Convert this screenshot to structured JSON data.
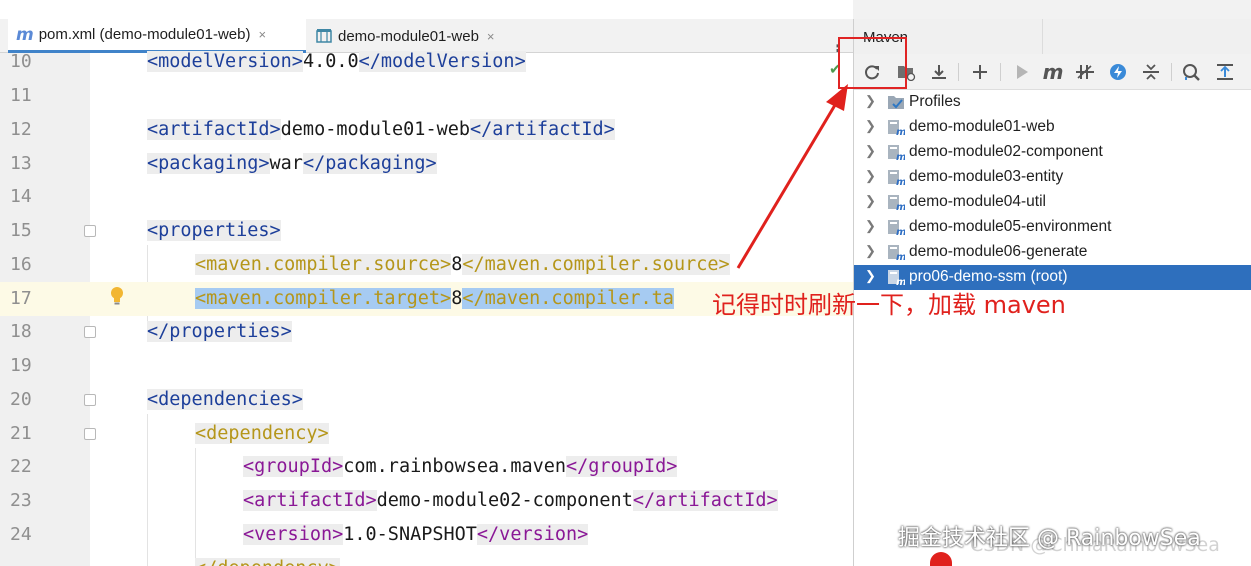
{
  "editor": {
    "tabs": [
      {
        "icon": "m",
        "label": "pom.xml (demo-module01-web)",
        "close": "×",
        "active": true
      },
      {
        "icon": "module",
        "label": "demo-module01-web",
        "close": "×",
        "active": false
      }
    ],
    "lines": [
      {
        "num": "10"
      },
      {
        "num": "11"
      },
      {
        "num": "12"
      },
      {
        "num": "13"
      },
      {
        "num": "14"
      },
      {
        "num": "15"
      },
      {
        "num": "16"
      },
      {
        "num": "17"
      },
      {
        "num": "18"
      },
      {
        "num": "19"
      },
      {
        "num": "20"
      },
      {
        "num": "21"
      },
      {
        "num": "22"
      },
      {
        "num": "23"
      },
      {
        "num": "24"
      }
    ],
    "code": {
      "l10": {
        "open": "<modelVersion>",
        "text": "4.0.0",
        "close": "</modelVersion>"
      },
      "l12": {
        "open": "<artifactId>",
        "text": "demo-module01-web",
        "close": "</artifactId>"
      },
      "l13": {
        "open": "<packaging>",
        "text": "war",
        "close": "</packaging>"
      },
      "l15": {
        "open": "<properties>"
      },
      "l16": {
        "open": "<maven.compiler.source>",
        "text": "8",
        "close": "</maven.compiler.source>"
      },
      "l17": {
        "open": "<maven.compiler.target>",
        "text": "8",
        "close": "</maven.compiler.ta"
      },
      "l18": {
        "close": "</properties>"
      },
      "l20": {
        "open": "<dependencies>"
      },
      "l21": {
        "open": "<dependency>"
      },
      "l22": {
        "open": "<groupId>",
        "text": "com.rainbowsea.maven",
        "close": "</groupId>"
      },
      "l23": {
        "open": "<artifactId>",
        "text": "demo-module02-component",
        "close": "</artifactId>"
      },
      "l24": {
        "open": "<version>",
        "text": "1.0-SNAPSHOT",
        "close": "</version>"
      },
      "l25": {
        "close": "</dependency>"
      }
    },
    "more_icon": "⋮"
  },
  "maven": {
    "title": "Maven",
    "toolbar": [
      "reload-icon",
      "generate-sources-icon",
      "download-icon",
      "add-icon",
      "run-icon",
      "execute-goal-icon",
      "toggle-offline-icon",
      "skip-tests-icon",
      "collapse-icon",
      "show-dependencies-icon",
      "expand-icon"
    ],
    "tree": [
      {
        "label": "Profiles",
        "icon": "profiles-icon",
        "selected": false
      },
      {
        "label": "demo-module01-web",
        "icon": "maven-module-icon",
        "selected": false
      },
      {
        "label": "demo-module02-component",
        "icon": "maven-module-icon",
        "selected": false
      },
      {
        "label": "demo-module03-entity",
        "icon": "maven-module-icon",
        "selected": false
      },
      {
        "label": "demo-module04-util",
        "icon": "maven-module-icon",
        "selected": false
      },
      {
        "label": "demo-module05-environment",
        "icon": "maven-module-icon",
        "selected": false
      },
      {
        "label": "demo-module06-generate",
        "icon": "maven-module-icon",
        "selected": false
      },
      {
        "label": "pro06-demo-ssm (root)",
        "icon": "maven-module-icon",
        "selected": true
      }
    ]
  },
  "annotation": {
    "text": "记得时时刷新一下，加载 maven",
    "color": "#e0211d"
  },
  "watermark": {
    "primary": "掘金技术社区 @ RainbowSea",
    "secondary": "CSDN @ChinaRainbowSea"
  },
  "colors": {
    "selection": "#2e6fbd",
    "tag_blue": "#1d3f9a",
    "tag_gold": "#b5961a",
    "tag_purple": "#8a1896",
    "text_selection": "#a6cbf2"
  }
}
